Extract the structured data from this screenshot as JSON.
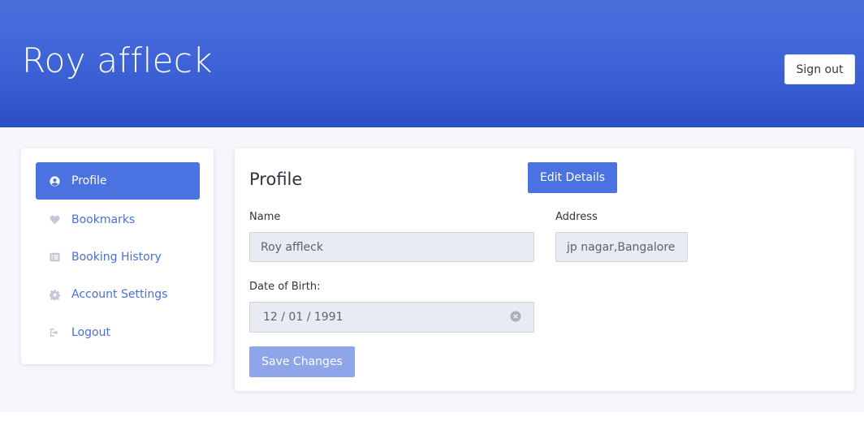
{
  "header": {
    "user_name": "Roy affleck",
    "signout_label": "Sign out"
  },
  "sidebar": {
    "items": [
      {
        "label": "Profile",
        "icon": "user-circle-icon",
        "active": true
      },
      {
        "label": "Bookmarks",
        "icon": "heart-icon"
      },
      {
        "label": "Booking History",
        "icon": "list-icon"
      },
      {
        "label": "Account Settings",
        "icon": "gear-icon"
      },
      {
        "label": "Logout",
        "icon": "sign-out-icon"
      }
    ]
  },
  "profile": {
    "title": "Profile",
    "edit_label": "Edit Details",
    "name_label": "Name",
    "name_value": "Roy affleck",
    "address_label": "Address",
    "address_value": "jp nagar,Bangalore",
    "dob_label": "Date of Birth:",
    "dob_value": "12 / 01 / 1991",
    "save_label": "Save Changes"
  },
  "colors": {
    "accent": "#4a72e0",
    "header_top": "#4a6fdc",
    "header_bottom": "#2a4fc4",
    "save_disabled": "#8ea5ea"
  }
}
